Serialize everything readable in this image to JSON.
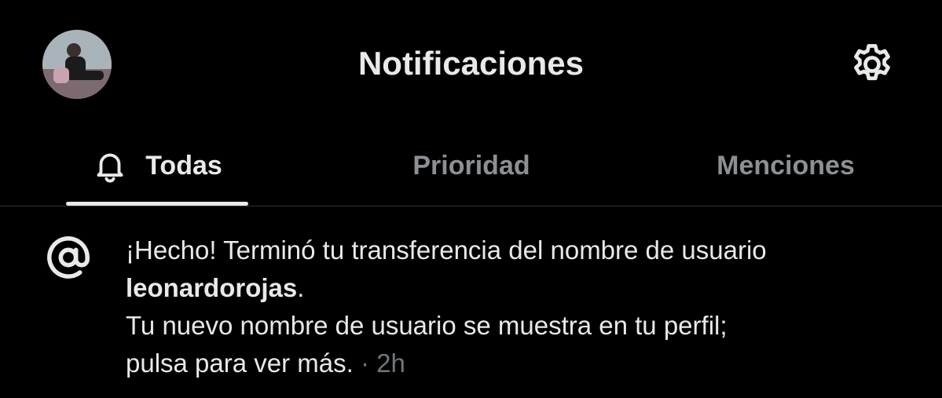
{
  "header": {
    "title": "Notificaciones",
    "avatar_icon": "profile-avatar",
    "settings_icon": "gear-icon"
  },
  "tabs": [
    {
      "label": "Todas",
      "icon": "bell-icon",
      "active": true
    },
    {
      "label": "Prioridad",
      "active": false
    },
    {
      "label": "Menciones",
      "active": false
    }
  ],
  "notification": {
    "icon": "at-sign-icon",
    "line1": "¡Hecho! Terminó tu transferencia del nombre de usuario",
    "username": "leonardorojas",
    "username_suffix": ".",
    "line3": "Tu nuevo nombre de usuario se muestra en tu perfil;",
    "line4": "pulsa para ver más.",
    "separator": " · ",
    "time": "2h"
  },
  "colors": {
    "background": "#000000",
    "text_primary": "#e7e9ea",
    "text_inactive_tab": "#8b9095",
    "text_secondary": "#71767b",
    "divider": "#2f3336"
  }
}
